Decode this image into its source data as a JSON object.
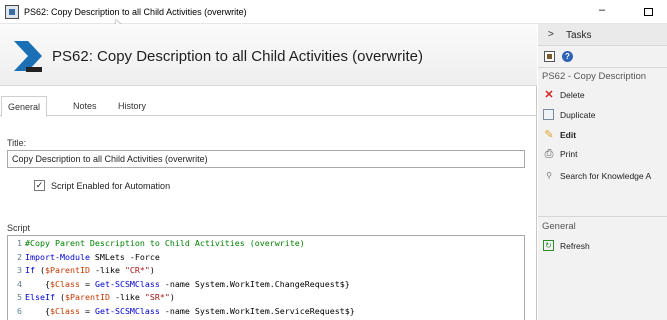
{
  "window": {
    "title": "PS62: Copy Description to all Child Activities (overwrite)",
    "minimize": "–"
  },
  "form": {
    "heading": "PS62: Copy Description to all Child Activities (overwrite)",
    "tabs": [
      {
        "label": "General",
        "active": true
      },
      {
        "label": "Notes",
        "active": false
      },
      {
        "label": "History",
        "active": false
      }
    ],
    "title_label": "Title:",
    "title_value": "Copy Description to all Child Activities (overwrite)",
    "checkbox_label": "Script Enabled for Automation",
    "checkbox_checked": true,
    "script_label": "Script",
    "script_lines": [
      {
        "n": "1",
        "parts": [
          {
            "t": "#Copy Parent Description to Child Activities (overwrite)",
            "c": "com"
          }
        ]
      },
      {
        "n": "2",
        "parts": [
          {
            "t": "Import-Module",
            "c": "kw"
          },
          {
            "t": " SMLets -Force",
            "c": "txt"
          }
        ]
      },
      {
        "n": "3",
        "parts": [
          {
            "t": "If",
            "c": "kw"
          },
          {
            "t": " (",
            "c": "txt"
          },
          {
            "t": "$ParentID",
            "c": "var"
          },
          {
            "t": " -like ",
            "c": "txt"
          },
          {
            "t": "\"CR*\"",
            "c": "str"
          },
          {
            "t": ")",
            "c": "txt"
          }
        ]
      },
      {
        "n": "4",
        "parts": [
          {
            "t": "    {",
            "c": "txt"
          },
          {
            "t": "$Class",
            "c": "var"
          },
          {
            "t": " = ",
            "c": "txt"
          },
          {
            "t": "Get-SCSMClass",
            "c": "kw"
          },
          {
            "t": " -name System.WorkItem.ChangeRequest$}",
            "c": "txt"
          }
        ]
      },
      {
        "n": "5",
        "parts": [
          {
            "t": "ElseIf",
            "c": "kw"
          },
          {
            "t": " (",
            "c": "txt"
          },
          {
            "t": "$ParentID",
            "c": "var"
          },
          {
            "t": " -like ",
            "c": "txt"
          },
          {
            "t": "\"SR*\"",
            "c": "str"
          },
          {
            "t": ")",
            "c": "txt"
          }
        ]
      },
      {
        "n": "6",
        "parts": [
          {
            "t": "    {",
            "c": "txt"
          },
          {
            "t": "$Class",
            "c": "var"
          },
          {
            "t": " = ",
            "c": "txt"
          },
          {
            "t": "Get-SCSMClass",
            "c": "kw"
          },
          {
            "t": " -name System.WorkItem.ServiceRequest$}",
            "c": "txt"
          }
        ]
      }
    ]
  },
  "tasks": {
    "header": "Tasks",
    "section_title": "PS62 - Copy Description",
    "items": [
      {
        "label": "Delete",
        "icon": "delete-icon",
        "bold": false
      },
      {
        "label": "Duplicate",
        "icon": "duplicate-icon",
        "bold": false
      },
      {
        "label": "Edit",
        "icon": "edit-icon",
        "bold": true
      },
      {
        "label": "Print",
        "icon": "print-icon",
        "bold": false
      },
      {
        "label": "Search for Knowledge A",
        "icon": "search-icon",
        "bold": false
      }
    ],
    "general_title": "General",
    "general_items": [
      {
        "label": "Refresh",
        "icon": "refresh-icon"
      }
    ]
  },
  "colors": {
    "accent": "#2e62b8",
    "logo": "#1a6fb5",
    "comment": "#008000",
    "keyword": "#0000cc",
    "variable": "#c23a00",
    "string": "#a31515"
  }
}
